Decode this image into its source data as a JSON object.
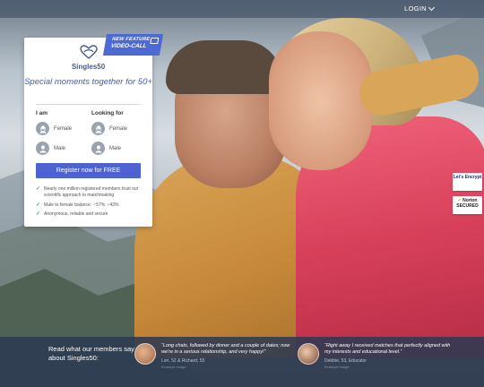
{
  "topbar": {
    "login_label": "LOGIN"
  },
  "card": {
    "badge_line1": "NEW FEATURE",
    "badge_line2": "VIDEO-CALL",
    "brand": "Singles50",
    "tagline": "Special moments together for 50+",
    "i_am_label": "I am",
    "looking_for_label": "Looking for",
    "i_am_options": [
      "Female",
      "Male"
    ],
    "looking_for_options": [
      "Female",
      "Male"
    ],
    "register_button": "Register now for FREE",
    "features": [
      "Nearly one million registered members trust our scientific approach to matchmaking",
      "Male to female balance: ♂57% ♀43%",
      "Anonymous, reliable and secure"
    ]
  },
  "trust_badges": {
    "letsencrypt": "Let's Encrypt",
    "norton": "Norton SECURED"
  },
  "bottom": {
    "read_more": "Read what our members say about Singles50:",
    "testimonials": [
      {
        "quote": "“Long chats, followed by dinner and a couple of dates; now we're in a serious relationship, and very happy!”",
        "author": "Lori, 52 & Richard, 55",
        "stock": "Example image"
      },
      {
        "quote": "“Right away I received matches that perfectly aligned with my interests and educational level.”",
        "author": "Debbie, 53, Educator",
        "stock": "Example image"
      }
    ]
  },
  "colors": {
    "accent": "#4d63d2",
    "tagline": "#3d5cc8",
    "bottom_band": "#2d3a52",
    "tick": "#3aa87a"
  }
}
